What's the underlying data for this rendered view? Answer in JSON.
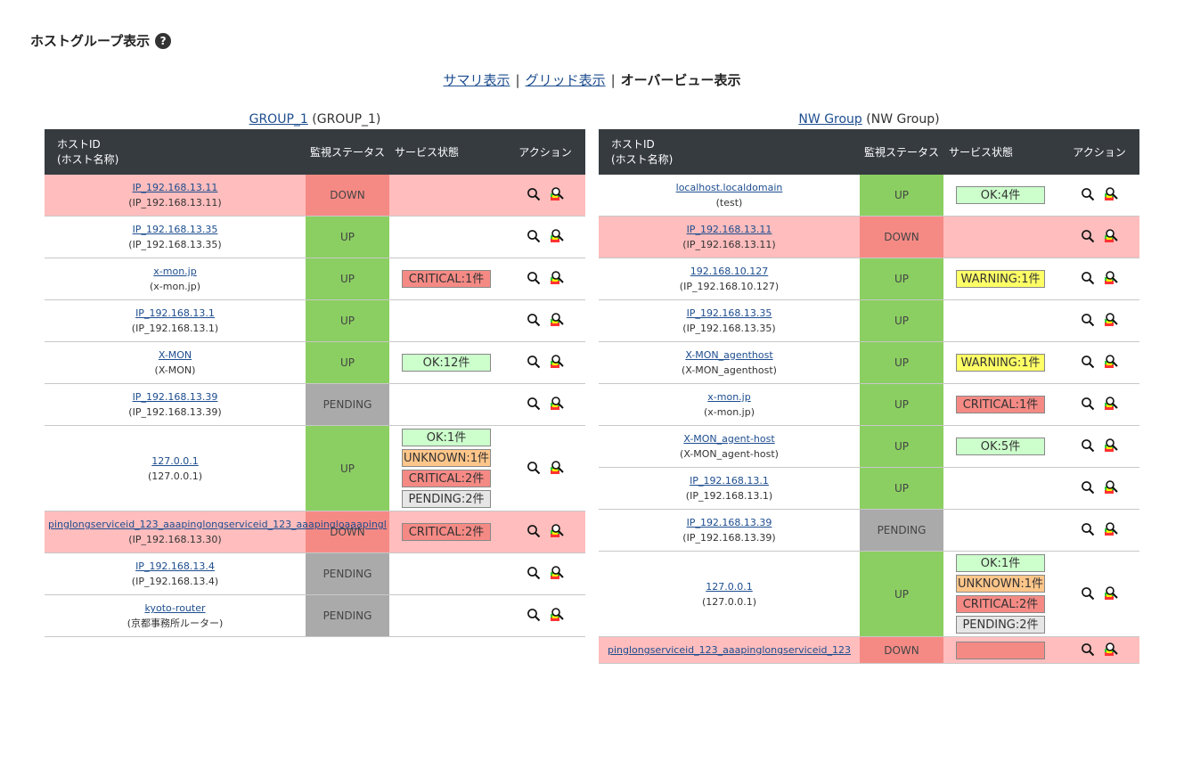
{
  "page": {
    "title": "ホストグループ表示",
    "help_glyph": "?",
    "nav": {
      "summary": "サマリ表示",
      "grid": "グリッド表示",
      "overview": "オーバービュー表示",
      "separator": "|"
    }
  },
  "table_headers": {
    "host_id": "ホストID",
    "host_name": "(ホスト名称)",
    "status": "監視ステータス",
    "services": "サービス状態",
    "actions": "アクション"
  },
  "icons": [
    "magnifier-icon",
    "host-detail-icon"
  ],
  "colors": {
    "up": "#8bcf62",
    "down": "#f58a85",
    "pending": "#aaaaaa",
    "row_down": "#ffbdbd",
    "header": "#363b40",
    "link": "#1d4d8f"
  },
  "groups": [
    {
      "link": "GROUP_1",
      "alias": "(GROUP_1)",
      "rows": [
        {
          "id": "IP_192.168.13.11",
          "name": "(IP_192.168.13.11)",
          "status": "DOWN",
          "services": []
        },
        {
          "id": "IP_192.168.13.35",
          "name": "(IP_192.168.13.35)",
          "status": "UP",
          "services": []
        },
        {
          "id": "x-mon.jp",
          "name": "(x-mon.jp)",
          "status": "UP",
          "services": [
            {
              "type": "critical",
              "label": "CRITICAL:1件"
            }
          ]
        },
        {
          "id": "IP_192.168.13.1",
          "name": "(IP_192.168.13.1)",
          "status": "UP",
          "services": []
        },
        {
          "id": "X-MON",
          "name": "(X-MON)",
          "status": "UP",
          "services": [
            {
              "type": "ok",
              "label": "OK:12件"
            }
          ]
        },
        {
          "id": "IP_192.168.13.39",
          "name": "(IP_192.168.13.39)",
          "status": "PENDING",
          "services": []
        },
        {
          "id": "127.0.0.1",
          "name": "(127.0.0.1)",
          "status": "UP",
          "services": [
            {
              "type": "ok",
              "label": "OK:1件"
            },
            {
              "type": "unknown",
              "label": "UNKNOWN:1件"
            },
            {
              "type": "critical",
              "label": "CRITICAL:2件"
            },
            {
              "type": "pending",
              "label": "PENDING:2件"
            }
          ]
        },
        {
          "id": "pinglongserviceid_123_aaapinglongserviceid_123_aaapingloaaapingl",
          "name": "(IP_192.168.13.30)",
          "status": "DOWN",
          "services": [
            {
              "type": "critical",
              "label": "CRITICAL:2件"
            }
          ]
        },
        {
          "id": "IP_192.168.13.4",
          "name": "(IP_192.168.13.4)",
          "status": "PENDING",
          "services": []
        },
        {
          "id": "kyoto-router",
          "name": "(京都事務所ルーター)",
          "status": "PENDING",
          "services": []
        }
      ]
    },
    {
      "link": "NW Group",
      "alias": "(NW Group)",
      "rows": [
        {
          "id": "localhost.localdomain",
          "name": "(test)",
          "status": "UP",
          "services": [
            {
              "type": "ok",
              "label": "OK:4件"
            }
          ]
        },
        {
          "id": "IP_192.168.13.11",
          "name": "(IP_192.168.13.11)",
          "status": "DOWN",
          "services": []
        },
        {
          "id": "192.168.10.127",
          "name": "(IP_192.168.10.127)",
          "status": "UP",
          "services": [
            {
              "type": "warning",
              "label": "WARNING:1件"
            }
          ]
        },
        {
          "id": "IP_192.168.13.35",
          "name": "(IP_192.168.13.35)",
          "status": "UP",
          "services": []
        },
        {
          "id": "X-MON_agenthost",
          "name": "(X-MON_agenthost)",
          "status": "UP",
          "services": [
            {
              "type": "warning",
              "label": "WARNING:1件"
            }
          ]
        },
        {
          "id": "x-mon.jp",
          "name": "(x-mon.jp)",
          "status": "UP",
          "services": [
            {
              "type": "critical",
              "label": "CRITICAL:1件"
            }
          ]
        },
        {
          "id": "X-MON_agent-host",
          "name": "(X-MON_agent-host)",
          "status": "UP",
          "services": [
            {
              "type": "ok",
              "label": "OK:5件"
            }
          ]
        },
        {
          "id": "IP_192.168.13.1",
          "name": "(IP_192.168.13.1)",
          "status": "UP",
          "services": []
        },
        {
          "id": "IP_192.168.13.39",
          "name": "(IP_192.168.13.39)",
          "status": "PENDING",
          "services": []
        },
        {
          "id": "127.0.0.1",
          "name": "(127.0.0.1)",
          "status": "UP",
          "services": [
            {
              "type": "ok",
              "label": "OK:1件"
            },
            {
              "type": "unknown",
              "label": "UNKNOWN:1件"
            },
            {
              "type": "critical",
              "label": "CRITICAL:2件"
            },
            {
              "type": "pending",
              "label": "PENDING:2件"
            }
          ]
        },
        {
          "id": "pinglongserviceid_123_aaapinglongserviceid_123",
          "name": "",
          "status": "DOWN",
          "services": [
            {
              "type": "critical",
              "label": ""
            }
          ]
        }
      ]
    }
  ]
}
